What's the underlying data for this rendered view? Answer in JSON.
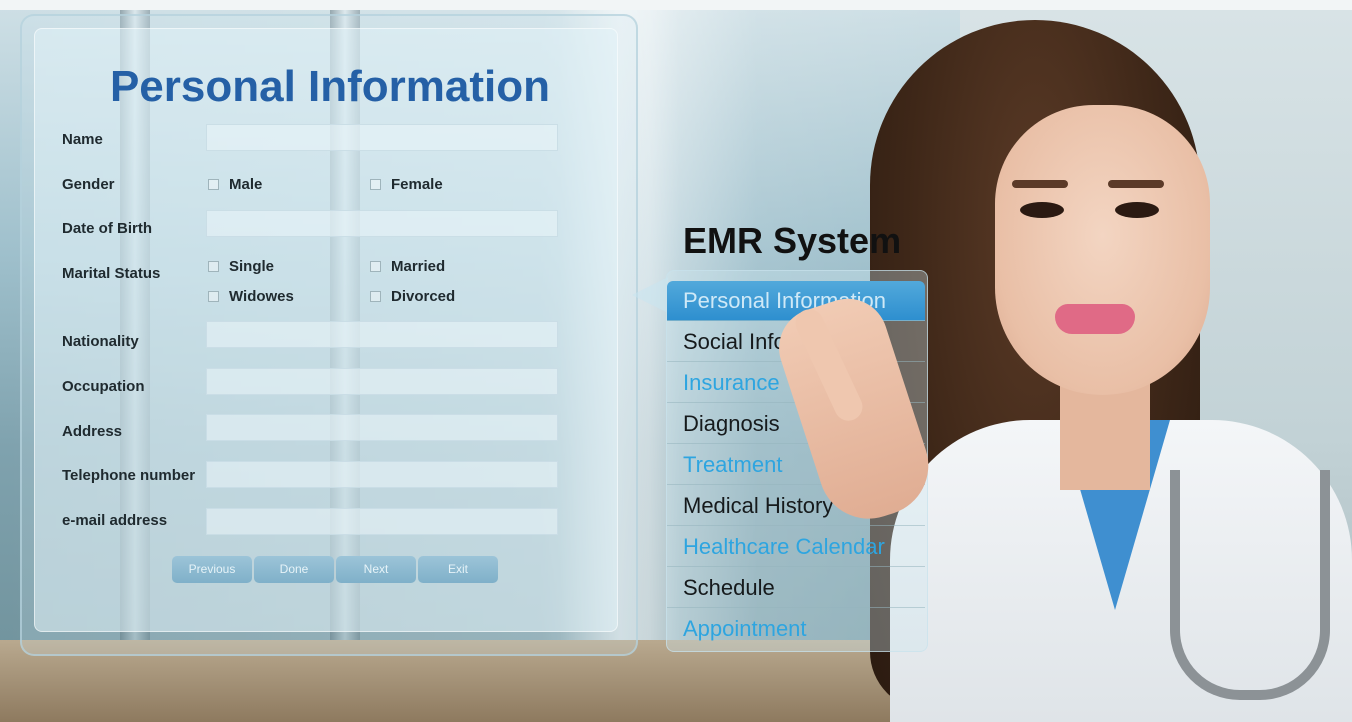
{
  "form": {
    "title": "Personal Information",
    "labels": {
      "name": "Name",
      "gender": "Gender",
      "dob": "Date of Birth",
      "marital": "Marital Status",
      "nationality": "Nationality",
      "occupation": "Occupation",
      "address": "Address",
      "telephone": "Telephone number",
      "email": "e-mail address"
    },
    "gender_options": [
      "Male",
      "Female"
    ],
    "marital_options": [
      "Single",
      "Married",
      "Widowes",
      "Divorced"
    ],
    "buttons": {
      "previous": "Previous",
      "done": "Done",
      "next": "Next",
      "exit": "Exit"
    }
  },
  "emr": {
    "title": "EMR System",
    "menu": [
      "Personal Information",
      "Social Information",
      "Insurance",
      "Diagnosis",
      "Treatment",
      "Medical History",
      "Healthcare Calendar",
      "Schedule",
      "Appointment"
    ]
  },
  "colors": {
    "title_blue": "#2560a6",
    "menu_active": "#2e8fcf",
    "menu_blue_text": "#2ea5e0"
  }
}
